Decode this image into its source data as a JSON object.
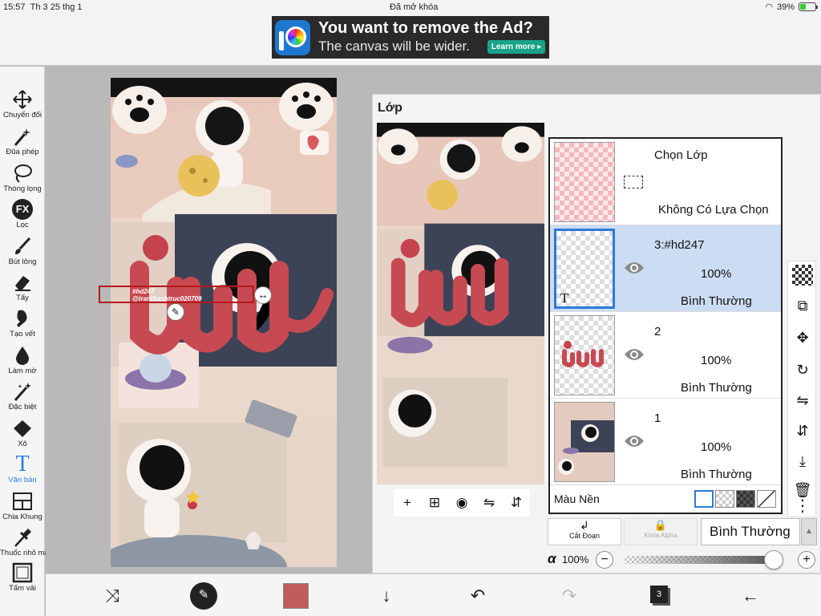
{
  "status": {
    "time": "15:57",
    "date": "Th 3 25 thg 1",
    "lock": "Đã mở khóa",
    "battery": "39%"
  },
  "ad": {
    "headline": "You want to remove the Ad?",
    "subline": "The canvas will be wider.",
    "button": "Learn more ▸"
  },
  "tools": [
    {
      "name": "transform",
      "label": "Chuyển đổi"
    },
    {
      "name": "magic-wand",
      "label": "Đũa phép"
    },
    {
      "name": "lasso",
      "label": "Thòng lọng"
    },
    {
      "name": "fx",
      "label": "Lọc",
      "icon_text": "FX"
    },
    {
      "name": "brush",
      "label": "Bút lông"
    },
    {
      "name": "eraser",
      "label": "Tẩy"
    },
    {
      "name": "smudge",
      "label": "Tạo vết"
    },
    {
      "name": "blur",
      "label": "Làm mờ"
    },
    {
      "name": "special",
      "label": "Đặc biệt"
    },
    {
      "name": "fill",
      "label": "Xô"
    },
    {
      "name": "text",
      "label": "Văn bản",
      "icon_text": "T",
      "active": true
    },
    {
      "name": "divide",
      "label": "Chia Khung"
    },
    {
      "name": "eyedropper",
      "label": "Thuốc nhỏ mắt"
    },
    {
      "name": "canvas",
      "label": "Tấm vải"
    }
  ],
  "canvas": {
    "text_box": "#hd247\n@tranthanhtruc020709"
  },
  "layers_panel": {
    "title": "Lớp",
    "selection_layer": {
      "name": "Chọn Lớp",
      "state": "Không Có Lựa Chọn"
    },
    "layers": [
      {
        "name": "3:#hd247",
        "opacity": "100%",
        "blend": "Bình Thường",
        "selected": true,
        "type_marker": "T"
      },
      {
        "name": "2",
        "opacity": "100%",
        "blend": "Bình Thường",
        "selected": false
      },
      {
        "name": "1",
        "opacity": "100%",
        "blend": "Bình Thường",
        "selected": false
      }
    ],
    "background_label": "Màu Nền",
    "clip_label": "Cắt Đoạn",
    "alpha_lock_label": "Khóa Alpha",
    "blend_mode": "Bình Thường",
    "alpha_symbol": "α",
    "alpha_value": "100%",
    "alpha_level": 1.0
  },
  "bottom": {
    "brush_size": "16",
    "layer_count": "3",
    "color": "#c05c5c"
  },
  "colors": {
    "accent": "#2a7de1",
    "selected_row": "#ccdcf3",
    "selection_box": "#b3191c"
  }
}
